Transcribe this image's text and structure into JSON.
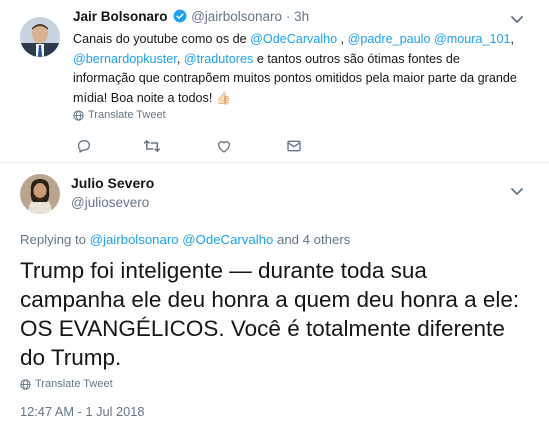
{
  "tweet1": {
    "name": "Jair Bolsonaro",
    "handle": "@jairbolsonaro",
    "sep": "·",
    "time": "3h",
    "text_before": "Canais do youtube como os de",
    "m1": "@OdeCarvalho",
    "comma": ",",
    "m2": "@padre_paulo",
    "m3": "@moura_101",
    "m4": "@bernardopkuster",
    "m5": "@tradutores",
    "text_after": "e tantos outros são ótimas fontes de informação que contrapõem muitos pontos omitidos pela maior parte da grande mídia! Boa noite a todos!",
    "emoji": "👍🏻",
    "translate": "Translate Tweet",
    "verified": true
  },
  "tweet2": {
    "name": "Julio Severo",
    "handle": "@juliosevero",
    "replying_to_label": "Replying to",
    "reply_m1": "@jairbolsonaro",
    "reply_m2": "@OdeCarvalho",
    "reply_rest": "and 4 others",
    "text": "Trump foi inteligente — durante toda sua campanha ele deu honra a quem deu honra a ele: OS EVANGÉLICOS. Você é totalmente diferente do Trump.",
    "translate": "Translate Tweet",
    "timestamp": "12:47 AM - 1 Jul 2018"
  },
  "colors": {
    "accent": "#1da1f2",
    "muted": "#657786",
    "text": "#14171a",
    "divider": "#e6ecf0"
  },
  "icons": [
    "verified-badge-icon",
    "chevron-down-icon",
    "globe-icon",
    "reply-icon",
    "retweet-icon",
    "like-icon",
    "direct-message-icon"
  ]
}
